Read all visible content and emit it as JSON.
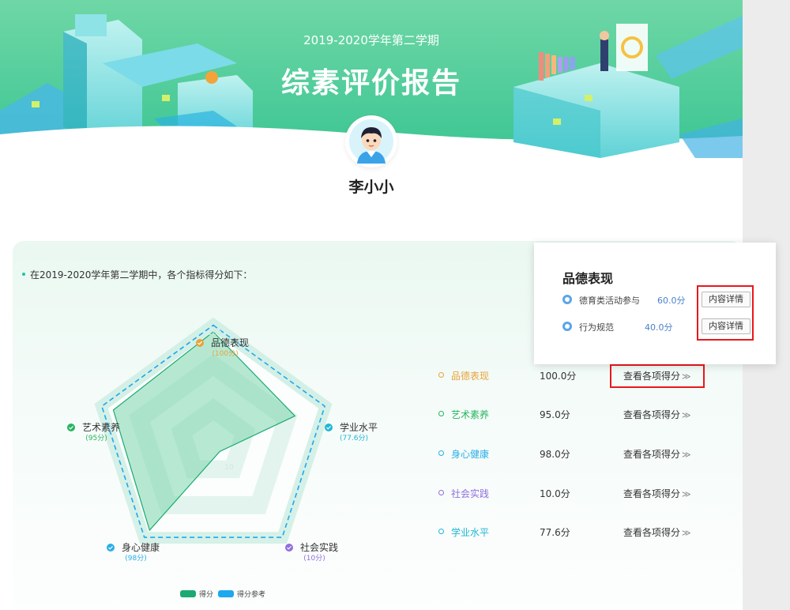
{
  "header": {
    "term": "2019-2020学年第二学期",
    "title": "综素评价报告"
  },
  "student": {
    "name": "李小小"
  },
  "intro": "在2019-2020学年第二学期中，各个指标得分如下：",
  "chart_data": {
    "type": "radar",
    "axes": [
      {
        "label": "品德表现",
        "score_text": "(100分)",
        "value": 100,
        "color": "#e8a33b"
      },
      {
        "label": "学业水平",
        "score_text": "(77.6分)",
        "value": 77.6,
        "color": "#1fb6d6"
      },
      {
        "label": "社会实践",
        "score_text": "(10分)",
        "value": 10,
        "color": "#8f6fe0"
      },
      {
        "label": "身心健康",
        "score_text": "(98分)",
        "value": 98,
        "color": "#2aaee8"
      },
      {
        "label": "艺术素养",
        "score_text": "(95分)",
        "value": 95,
        "color": "#27b561"
      }
    ],
    "ticks": [
      "10",
      "100"
    ],
    "range": [
      0,
      100
    ],
    "series": [
      {
        "name": "得分",
        "values": [
          100,
          77.6,
          10,
          98,
          95
        ],
        "color": "#1aaa72"
      },
      {
        "name": "得分参考",
        "values": [
          100,
          100,
          100,
          100,
          100
        ],
        "color": "#1ea8ee"
      }
    ]
  },
  "scores": [
    {
      "name": "品德表现",
      "value": "100.0分",
      "color": "#e8a33b"
    },
    {
      "name": "艺术素养",
      "value": "95.0分",
      "color": "#27b561"
    },
    {
      "name": "身心健康",
      "value": "98.0分",
      "color": "#2aaee8"
    },
    {
      "name": "社会实践",
      "value": "10.0分",
      "color": "#8f6fe0"
    },
    {
      "name": "学业水平",
      "value": "77.6分",
      "color": "#1fb6d6"
    }
  ],
  "view_items_label": "查看各项得分",
  "popup": {
    "title": "品德表现",
    "rows": [
      {
        "label": "德育类活动参与",
        "score": "60.0分",
        "button": "内容详情"
      },
      {
        "label": "行为规范",
        "score": "40.0分",
        "button": "内容详情"
      }
    ]
  },
  "icons": [
    "avatar-icon",
    "check-badge-icon",
    "double-chevron-right-icon",
    "circle-dot-icon"
  ]
}
